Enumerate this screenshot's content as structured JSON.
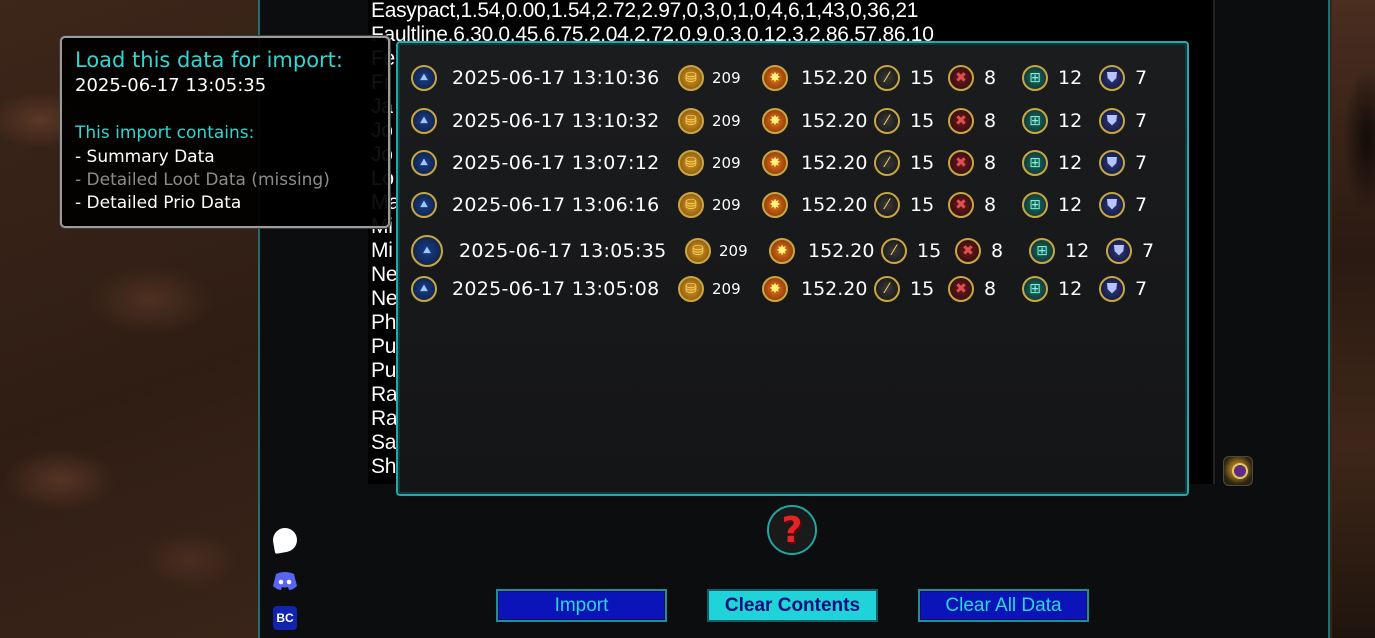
{
  "csv_lines": [
    "Easypact,1.54,0.00,1.54,2.72,2.97,0,3,0,1,0,4,6,1,43,0,36,21",
    "Faultline,6.30,0.45,6.75,2.04,2.72,0,9,0,3,0,12,3,2,86,57,86,10",
    "Fe",
    "Fr",
    "Ja",
    "Jo",
    "Jo",
    "Lo",
    "Ma",
    "Mi",
    "Mi",
    "Ne",
    "Ne",
    "Ph",
    "Pu",
    "Pu",
    "Ra",
    "Ra",
    "Sa",
    "Sh"
  ],
  "history": [
    {
      "date": "2025-06-17 13:10:36",
      "coins": "209",
      "score": "152.20",
      "wand": "15",
      "cross": "8",
      "plus": "12",
      "shield": "7"
    },
    {
      "date": "2025-06-17 13:10:32",
      "coins": "209",
      "score": "152.20",
      "wand": "15",
      "cross": "8",
      "plus": "12",
      "shield": "7"
    },
    {
      "date": "2025-06-17 13:07:12",
      "coins": "209",
      "score": "152.20",
      "wand": "15",
      "cross": "8",
      "plus": "12",
      "shield": "7"
    },
    {
      "date": "2025-06-17 13:06:16",
      "coins": "209",
      "score": "152.20",
      "wand": "15",
      "cross": "8",
      "plus": "12",
      "shield": "7"
    },
    {
      "date": "2025-06-17 13:05:35",
      "coins": "209",
      "score": "152.20",
      "wand": "15",
      "cross": "8",
      "plus": "12",
      "shield": "7"
    },
    {
      "date": "2025-06-17 13:05:08",
      "coins": "209",
      "score": "152.20",
      "wand": "15",
      "cross": "8",
      "plus": "12",
      "shield": "7"
    }
  ],
  "icons": {
    "row_lead": "runestone-icon",
    "coins": "coin-pile-icon",
    "score": "star-burst-icon",
    "wand": "wand-icon",
    "cross": "crossed-swords-icon",
    "plus": "add-item-icon",
    "shield": "shield-icon"
  },
  "tooltip": {
    "title": "Load this data for import:",
    "timestamp": "2025-06-17 13:05:35",
    "contains_heading": "This import contains:",
    "items": [
      {
        "text": "- Summary Data",
        "missing": false
      },
      {
        "text": "- Detailed Loot Data (missing)",
        "missing": true
      },
      {
        "text": "- Detailed Prio Data",
        "missing": false
      }
    ]
  },
  "help": {
    "glyph": "?"
  },
  "buttons": {
    "import": "Import",
    "clear_contents": "Clear Contents",
    "clear_all": "Clear All Data"
  },
  "side_icons": {
    "patreon": "Patreon",
    "discord": "Discord",
    "bc": "BC"
  },
  "colors": {
    "accent_teal": "#2fd6d2",
    "button_blue": "#0b14b8",
    "button_cyan": "#1fd3d8",
    "help_red": "#e12525"
  }
}
